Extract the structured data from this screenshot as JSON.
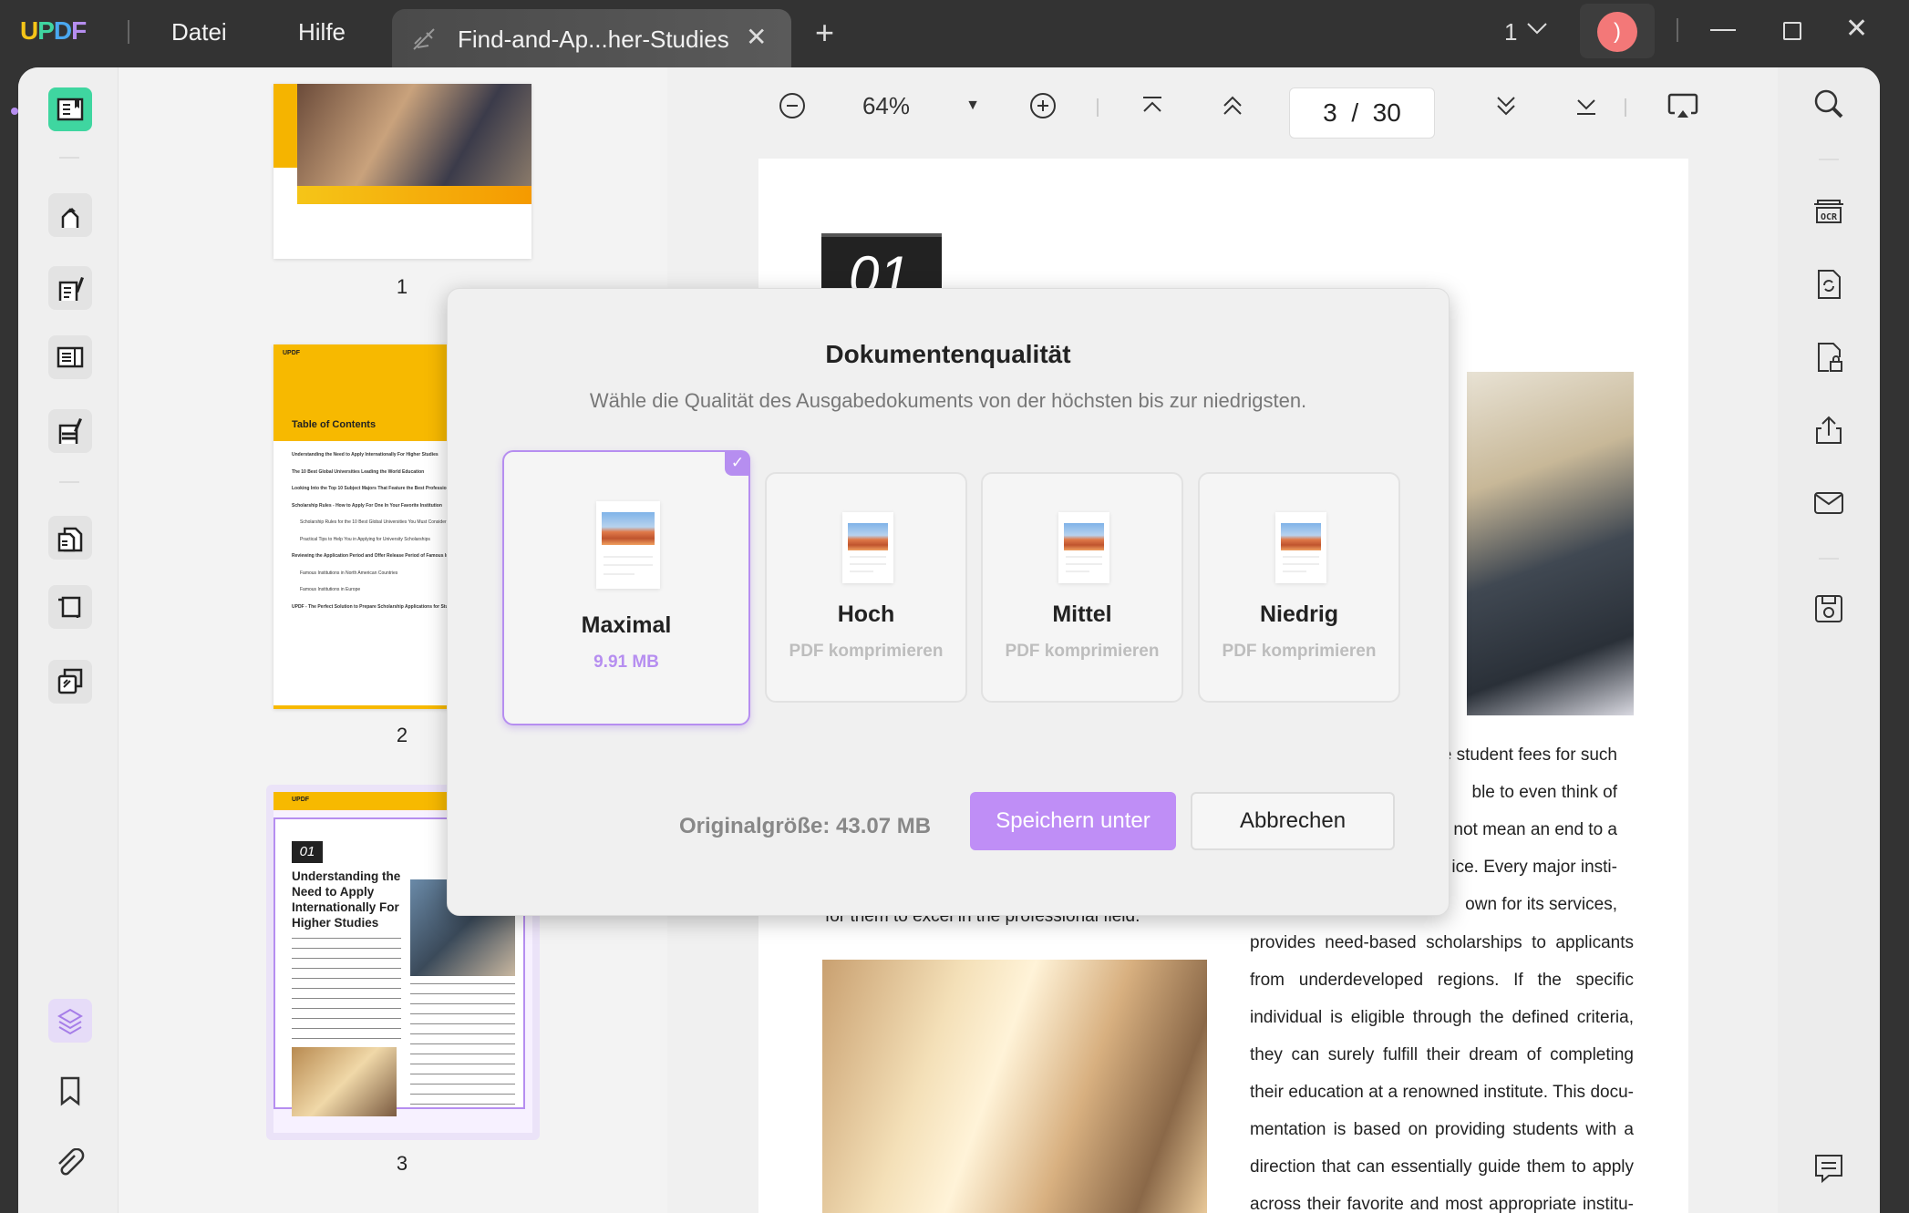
{
  "titlebar": {
    "logo": "UPDF",
    "menu": [
      "Datei",
      "Hilfe"
    ],
    "tab_title": "Find-and-Ap...her-Studies",
    "tab_icon": "unlink-icon",
    "window_count": "1",
    "colors": {
      "bg": "#333333",
      "avatar": "#f37878",
      "accent": "#b68ef0",
      "highlight": "#3fd6a0"
    }
  },
  "toolbar": {
    "zoom": "64%",
    "current_page": "3",
    "page_sep": "/",
    "total_pages": "30"
  },
  "thumbnails": [
    {
      "label": "1"
    },
    {
      "label": "2",
      "brand": "UPDF",
      "title": "Table of Contents",
      "toc": [
        "Understanding the Need to Apply Internationally For Higher Studies",
        "The 10 Best Global Universities Leading the World Education",
        "Looking Into the Top 10 Subject Majors That Feature the Best Professional Expos",
        "Scholarship Rules - How to Apply For One In Your Favorite Institution",
        "Scholarship Rules for the 10 Best Global Universities You Must Consider",
        "Practical Tips to Help You in Applying for University Scholarships",
        "Reviewing the Application Period and Offer Release Period of Famous Institutio",
        "Famous Institutions in North American Countries",
        "Famous Institutions in Europe",
        "UPDF - The Perfect Solution to Prepare Scholarship Applications for Students"
      ]
    },
    {
      "label": "3",
      "brand": "UPDF",
      "number": "01",
      "title": "Understanding the Need to Apply Internationally For Higher Studies"
    }
  ],
  "page": {
    "chapter_number": "01",
    "left_line": "for them to excel in the professional field.",
    "right_lines": [
      "e student fees for such",
      "ble to even think of",
      "s not mean an end to a",
      "ice. Every major insti-",
      "own for its services,",
      "provides need-based scholarships to applicants",
      "from underdeveloped regions. If the specific",
      "individual is eligible through the defined criteria,",
      "they can surely fulfill their dream of completing",
      "their education at a renowned institute. This docu-",
      "mentation is based on providing students with a",
      "direction that can essentially guide them to apply",
      "across their favorite and most appropriate institu-"
    ]
  },
  "dialog": {
    "title": "Dokumentenqualität",
    "subtitle": "Wähle die Qualität des Ausgabedokuments von der höchsten bis zur niedrigsten.",
    "options": [
      {
        "name": "Maximal",
        "sub": "9.91 MB",
        "selected": true
      },
      {
        "name": "Hoch",
        "sub": "PDF komprimieren",
        "selected": false
      },
      {
        "name": "Mittel",
        "sub": "PDF komprimieren",
        "selected": false
      },
      {
        "name": "Niedrig",
        "sub": "PDF komprimieren",
        "selected": false
      }
    ],
    "original_size": "Originalgröße: 43.07 MB",
    "save_label": "Speichern unter",
    "cancel_label": "Abbrechen"
  }
}
